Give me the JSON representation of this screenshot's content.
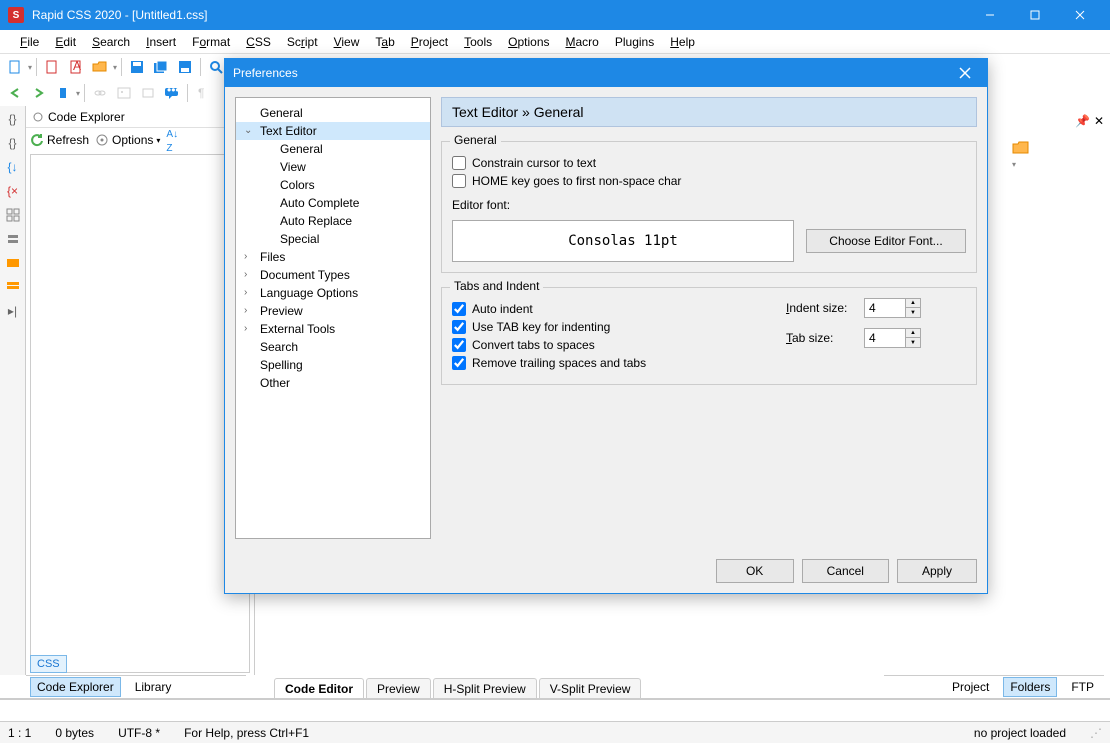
{
  "app": {
    "title": "Rapid CSS 2020 - [Untitled1.css]"
  },
  "menu": [
    "File",
    "Edit",
    "Search",
    "Insert",
    "Format",
    "CSS",
    "Script",
    "View",
    "Tab",
    "Project",
    "Tools",
    "Options",
    "Macro",
    "Plugins",
    "Help"
  ],
  "code_explorer": {
    "title": "Code Explorer",
    "refresh": "Refresh",
    "options": "Options"
  },
  "panel_tabs": {
    "code_explorer": "Code Explorer",
    "library": "Library"
  },
  "bottom_tabs": {
    "code_editor": "Code Editor",
    "preview": "Preview",
    "hsplit": "H-Split Preview",
    "vsplit": "V-Split Preview"
  },
  "right_tabs": {
    "project": "Project",
    "folders": "Folders",
    "ftp": "FTP"
  },
  "css_badge": "CSS",
  "status": {
    "pos": "1 : 1",
    "size": "0 bytes",
    "enc": "UTF-8 *",
    "help": "For Help, press Ctrl+F1",
    "project": "no project loaded"
  },
  "prefs": {
    "title": "Preferences",
    "header": "Text Editor » General",
    "tree": {
      "general": "General",
      "text_editor": "Text Editor",
      "te_general": "General",
      "te_view": "View",
      "te_colors": "Colors",
      "te_autocomplete": "Auto Complete",
      "te_autoreplace": "Auto Replace",
      "te_special": "Special",
      "files": "Files",
      "doctypes": "Document Types",
      "lang": "Language Options",
      "preview": "Preview",
      "ext_tools": "External Tools",
      "search": "Search",
      "spelling": "Spelling",
      "other": "Other"
    },
    "group_general": "General",
    "constrain": "Constrain cursor to text",
    "homekey": "HOME key goes to first non-space char",
    "editor_font_label": "Editor font:",
    "font_preview": "Consolas 11pt",
    "choose_font": "Choose Editor Font...",
    "group_tabs": "Tabs and Indent",
    "auto_indent": "Auto indent",
    "use_tab": "Use TAB key for indenting",
    "convert_tabs": "Convert tabs to spaces",
    "remove_trailing": "Remove trailing spaces and tabs",
    "indent_size_label": "Indent size:",
    "indent_size": "4",
    "tab_size_label": "Tab size:",
    "tab_size": "4",
    "ok": "OK",
    "cancel": "Cancel",
    "apply": "Apply"
  }
}
